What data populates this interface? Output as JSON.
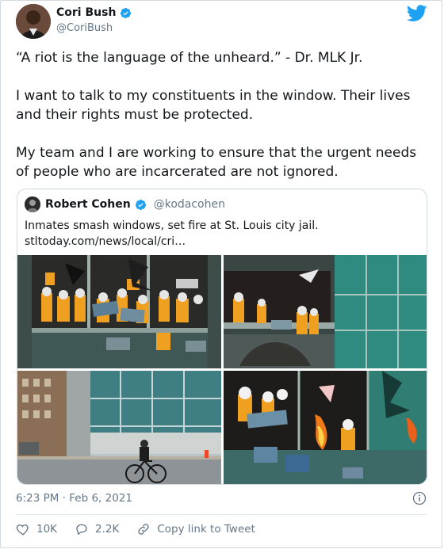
{
  "author": {
    "name": "Cori Bush",
    "handle": "@CoriBush"
  },
  "tweet_text": "“A riot is the language of the unheard.” - Dr. MLK Jr.\n\nI want to talk to my constituents in the window. Their lives and their rights must be protected.\n\nMy team and I are working to ensure that the urgent needs of people who are incarcerated are not ignored.",
  "quoted": {
    "name": "Robert Cohen",
    "handle": "@kodacohen",
    "text_line1": "Inmates smash windows, set fire at St. Louis city jail.",
    "text_line2": "stltoday.com/news/local/cri…"
  },
  "photos": [
    "inmates-window-photo",
    "jail-building-corner-photo",
    "cyclist-street-photo",
    "window-fire-photo"
  ],
  "window_signs": [
    "WE NEED HELP",
    "TOTAL COVID",
    "WHAT'S THE PLAN",
    "INJURED",
    "CRIMES",
    "WE NEED",
    "ILOST",
    "WHAT ABOUT",
    "83"
  ],
  "timestamp": "6:23 PM · Feb 6, 2021",
  "actions": {
    "likes": "10K",
    "replies": "2.2K",
    "copy_link": "Copy link to Tweet"
  },
  "colors": {
    "brand_blue": "#1da1f2",
    "text": "#14171a",
    "muted": "#657786",
    "border": "#cfd9de"
  },
  "icons": [
    "verified-badge-icon",
    "twitter-bird-icon",
    "info-icon",
    "heart-icon",
    "reply-icon",
    "link-icon"
  ]
}
